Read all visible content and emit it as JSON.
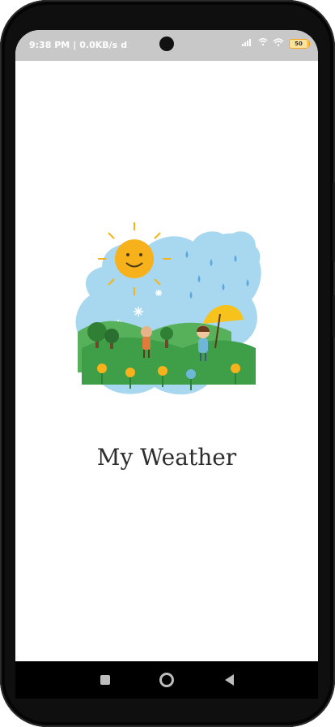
{
  "status_bar": {
    "time": "9:38 PM",
    "network_speed": "0.0KB/s",
    "app_icon": "d",
    "battery_level": "50",
    "icons": [
      "signal-icon",
      "wifi-icon",
      "battery-icon"
    ]
  },
  "splash": {
    "title": "My Weather"
  },
  "nav_bar": {
    "icons": [
      "recent-apps-icon",
      "home-icon",
      "back-icon"
    ]
  },
  "colors": {
    "sky": "#a8d7f0",
    "sun": "#f7b21b",
    "grass": "#4caf50",
    "status_bar": "#c8c8c8",
    "title_text": "#2d2d2d"
  }
}
